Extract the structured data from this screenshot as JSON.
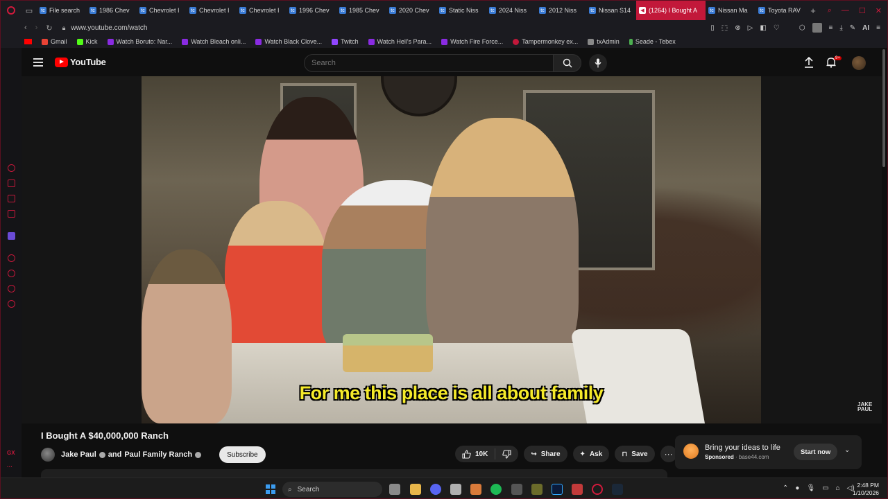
{
  "browser": {
    "tabs": [
      {
        "label": "File search"
      },
      {
        "label": "1986 Chev"
      },
      {
        "label": "Chevrolet I"
      },
      {
        "label": "Chevrolet I"
      },
      {
        "label": "Chevrolet I"
      },
      {
        "label": "1996 Chev"
      },
      {
        "label": "1985 Chev"
      },
      {
        "label": "2020 Chev"
      },
      {
        "label": "Static Niss"
      },
      {
        "label": "2024 Niss"
      },
      {
        "label": "2012 Niss"
      },
      {
        "label": "Nissan S14"
      },
      {
        "label": "(1264) I Bought A"
      },
      {
        "label": "Nissan Ma"
      },
      {
        "label": "Toyota RAV"
      }
    ],
    "url": "www.youtube.com/watch",
    "ai_label": "AI",
    "bookmarks": [
      {
        "label": "Gmail",
        "color": "#ea4335"
      },
      {
        "label": "Kick",
        "color": "#53fc18"
      },
      {
        "label": "Watch Boruto: Nar...",
        "color": "#8a2be2"
      },
      {
        "label": "Watch Bleach onli...",
        "color": "#8a2be2"
      },
      {
        "label": "Watch Black Clove...",
        "color": "#8a2be2"
      },
      {
        "label": "Twitch",
        "color": "#9146ff"
      },
      {
        "label": "Watch Hell's Para...",
        "color": "#8a2be2"
      },
      {
        "label": "Watch Fire Force...",
        "color": "#8a2be2"
      },
      {
        "label": "Tampermonkey ex...",
        "color": "#c2183a"
      },
      {
        "label": "txAdmin",
        "color": "#888888"
      },
      {
        "label": "Seade - Tebex",
        "color": "#4caf50"
      }
    ],
    "sidebar_gx": "GX"
  },
  "youtube": {
    "logo_text": "YouTube",
    "search_placeholder": "Search",
    "notif_badge": "9+",
    "subtitle": "For me this place is all about family",
    "watermark": "JAKE PAUL",
    "video_title": "I Bought A $40,000,000 Ranch",
    "channel_prefix": "Jake Paul",
    "channel_joiner": "and",
    "channel_second": "Paul Family Ranch",
    "subscribe": "Subscribe",
    "likes": "10K",
    "share": "Share",
    "ask": "Ask",
    "save": "Save",
    "ad": {
      "title": "Bring your ideas to life",
      "sponsored": "Sponsored",
      "domain": "base44.com",
      "cta": "Start now"
    }
  },
  "taskbar": {
    "search": "Search",
    "time": "2:48 PM",
    "date": "1/10/2026"
  },
  "colors": {
    "accent": "#c2183a",
    "yt_red": "#ff0000",
    "subtitle": "#f5ea2a"
  }
}
